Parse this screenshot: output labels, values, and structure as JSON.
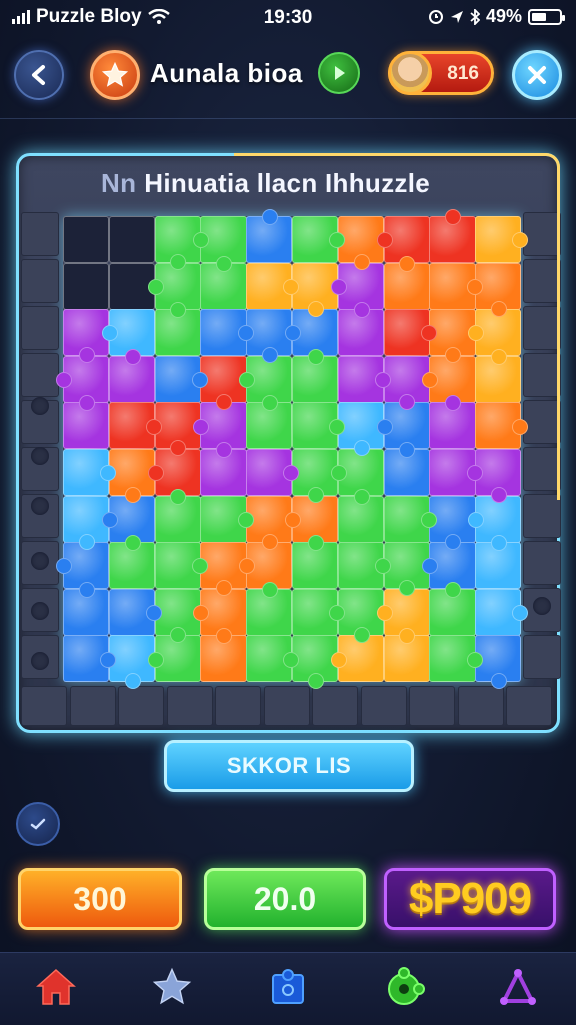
{
  "status_bar": {
    "carrier": "Puzzle Bloy",
    "time": "19:30",
    "battery": "49%"
  },
  "header": {
    "title": "Aunala bioa",
    "score": "816"
  },
  "board": {
    "title_prefix": "Nn",
    "title": "Hinuatia llacn Ihhuzzle"
  },
  "actions": {
    "main_button": "SKKOR LIS",
    "stat_orange": "300",
    "stat_green": "20.0",
    "stat_gold": "$P909"
  },
  "nav": {
    "items": [
      "home-icon",
      "star-icon",
      "puzzle-box-icon",
      "puzzle-piece-icon",
      "triangle-icon"
    ]
  },
  "colors": {
    "cyan": "#3fb8ff",
    "green": "#3fd64a",
    "orange": "#ff7a18",
    "red": "#ee3322",
    "purple": "#a534e0",
    "blue": "#2a7ff0",
    "yellow": "#ffb020"
  }
}
